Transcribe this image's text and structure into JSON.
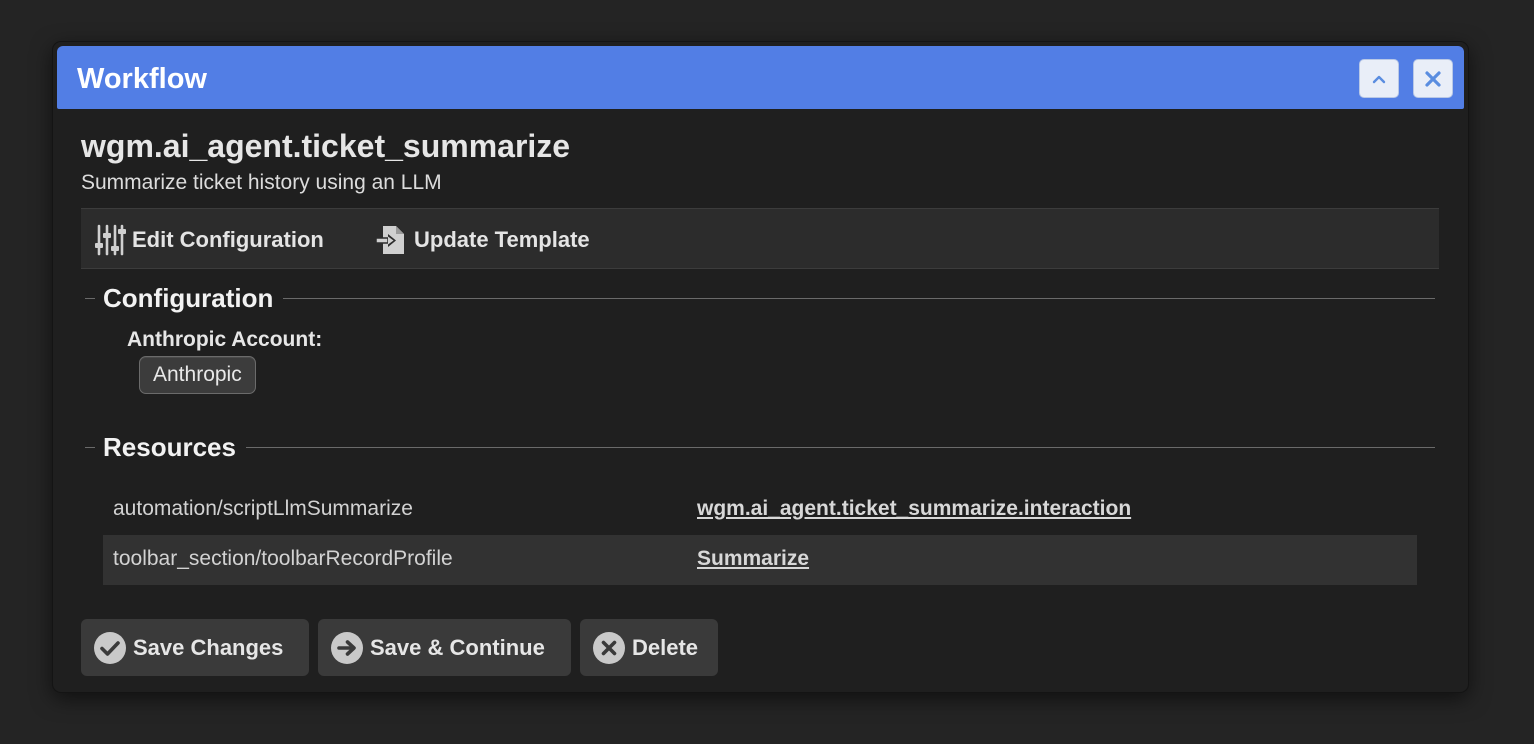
{
  "dialog": {
    "title": "Workflow",
    "collapse_icon": "chevron-up-icon",
    "close_icon": "close-icon"
  },
  "workflow": {
    "name": "wgm.ai_agent.ticket_summarize",
    "description": "Summarize ticket history using an LLM"
  },
  "toolbar": {
    "edit_label": "Edit Configuration",
    "edit_icon": "sliders-icon",
    "update_label": "Update Template",
    "update_icon": "import-file-icon"
  },
  "configuration": {
    "heading": "Configuration",
    "fields": [
      {
        "label": "Anthropic Account:",
        "value": "Anthropic"
      }
    ]
  },
  "resources": {
    "heading": "Resources",
    "rows": [
      {
        "key": "automation/scriptLlmSummarize",
        "link": "wgm.ai_agent.ticket_summarize.interaction"
      },
      {
        "key": "toolbar_section/toolbarRecordProfile",
        "link": "Summarize"
      }
    ]
  },
  "footer": {
    "save_label": "Save Changes",
    "continue_label": "Save & Continue",
    "delete_label": "Delete"
  },
  "colors": {
    "titlebar": "#527ee5",
    "background": "#1f1f1f",
    "button": "#3a3a3a"
  }
}
